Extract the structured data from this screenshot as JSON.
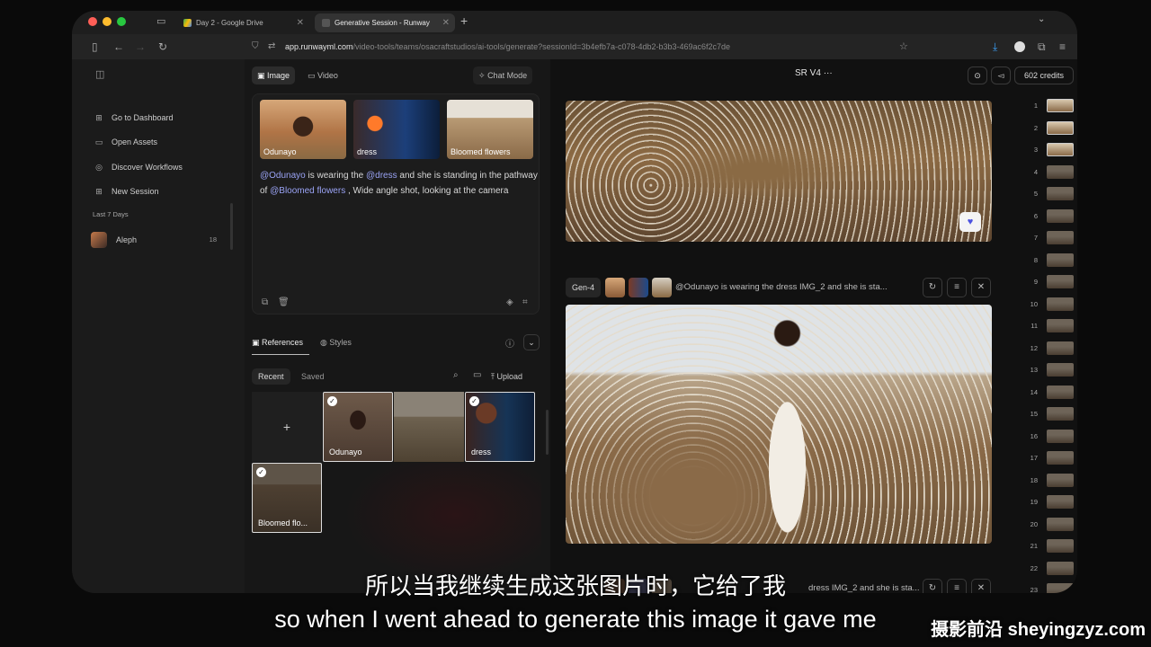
{
  "browser": {
    "tabs": [
      {
        "label": "Day 2 - Google Drive"
      },
      {
        "label": "Generative Session - Runway"
      }
    ],
    "url_host": "app.runwayml.com",
    "url_path": "/video-tools/teams/osacraftstudios/ai-tools/generate?sessionId=3b4efb7a-c078-4db2-b3b3-469ac6f2c7de"
  },
  "sidebar": {
    "items": [
      {
        "label": "Go to Dashboard",
        "icon": "dashboard-icon"
      },
      {
        "label": "Open Assets",
        "icon": "folder-icon"
      },
      {
        "label": "Discover Workflows",
        "icon": "globe-icon"
      },
      {
        "label": "New Session",
        "icon": "plus-square-icon"
      }
    ],
    "section_label": "Last 7 Days",
    "sessions": [
      {
        "label": "Aleph",
        "count": "18"
      }
    ]
  },
  "mid": {
    "tabs": [
      "Image",
      "Video"
    ],
    "chat_mode": "Chat Mode",
    "thumbs": [
      "Odunayo",
      "dress",
      "Bloomed flowers"
    ],
    "prompt": {
      "m1": "@Odunayo",
      "t1": " is wearing the ",
      "m2": "@dress",
      "t2": " and she is standing in the pathway of ",
      "m3": "@Bloomed flowers",
      "t3": " , Wide angle shot, looking at the camera"
    },
    "ref_tabs": [
      "References",
      "Styles"
    ],
    "sub_tabs": [
      "Recent",
      "Saved"
    ],
    "upload": "Upload",
    "add": "+",
    "grid": [
      {
        "label": "Odunayo",
        "checked": true
      },
      {
        "label": "",
        "checked": false
      },
      {
        "label": "dress",
        "checked": true
      },
      {
        "label": "Bloomed flo...",
        "checked": true
      }
    ]
  },
  "right": {
    "model": "SR V4",
    "menu": "···",
    "credits": "602 credits",
    "gen_badge": "Gen-4",
    "gen_prompt": "@Odunayo is wearing the dress IMG_2 and she is sta...",
    "gen_prompt_cut": "dress IMG_2 and she is sta...",
    "filmstrip_count": 23
  },
  "subtitles": {
    "cn": "所以当我继续生成这张图片时，它给了我",
    "en": "so when I went ahead to generate this image it gave me"
  },
  "watermark": "摄影前沿 sheyingzyz.com",
  "colors": {
    "accent": "#9aa3f5",
    "favorite": "#4b52e0"
  }
}
